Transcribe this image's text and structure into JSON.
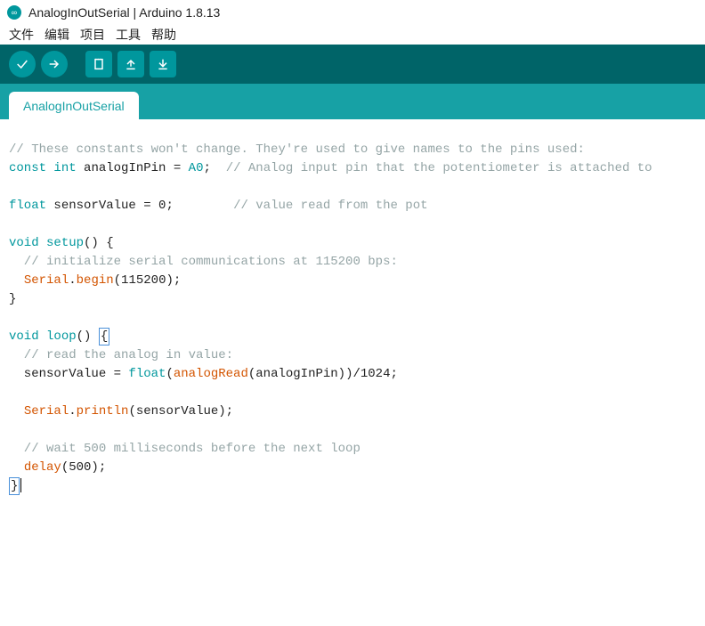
{
  "window": {
    "title": "AnalogInOutSerial | Arduino 1.8.13"
  },
  "menu": {
    "file": "文件",
    "edit": "编辑",
    "sketch": "项目",
    "tools": "工具",
    "help": "帮助"
  },
  "toolbar_icons": {
    "verify": "verify-icon",
    "upload": "upload-icon",
    "new": "new-icon",
    "open": "open-icon",
    "save": "save-icon"
  },
  "tabs": {
    "active": "AnalogInOutSerial"
  },
  "code": {
    "l1_a": "// These constants won't change. They're used to give names to the pins used:",
    "l2_kw1": "const",
    "l2_kw2": "int",
    "l2_txt": " analogInPin = ",
    "l2_const": "A0",
    "l2_semi": ";  ",
    "l2_cmt": "// Analog input pin that the potentiometer is attached to",
    "l3_kw": "float",
    "l3_txt": " sensorValue = 0;        ",
    "l3_cmt": "// value read from the pot",
    "l4_kw": "void",
    "l4_fn": "setup",
    "l4_tail": "() {",
    "l5_cmt": "  // initialize serial communications at 115200 bps:",
    "l6_a": "  ",
    "l6_obj": "Serial",
    "l6_dot": ".",
    "l6_fn": "begin",
    "l6_tail": "(115200);",
    "l7": "}",
    "l8_kw": "void",
    "l8_fn": "loop",
    "l8_par": "() ",
    "l8_brace": "{",
    "l9_cmt": "  // read the analog in value:",
    "l10_a": "  sensorValue = ",
    "l10_fn1": "float",
    "l10_b": "(",
    "l10_fn2": "analogRead",
    "l10_c": "(analogInPin))/1024;",
    "l11_a": "  ",
    "l11_obj": "Serial",
    "l11_dot": ".",
    "l11_fn": "println",
    "l11_tail": "(sensorValue);",
    "l12_cmt": "  // wait 500 milliseconds before the next loop",
    "l13_a": "  ",
    "l13_fn": "delay",
    "l13_tail": "(500);",
    "l14": "}"
  }
}
